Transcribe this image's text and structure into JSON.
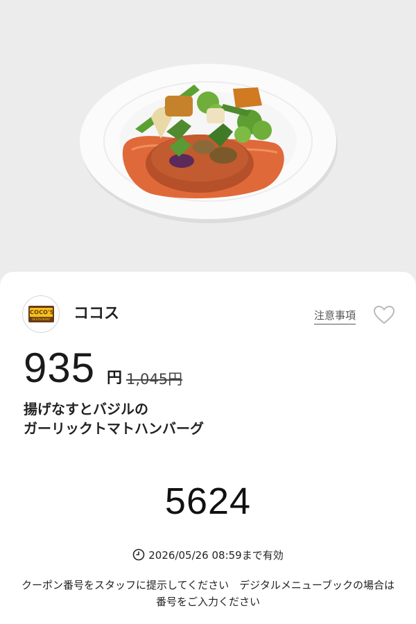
{
  "brand": {
    "name": "ココス",
    "logo_text": "COCO'S",
    "logo_subtext": "RESTAURANT"
  },
  "actions": {
    "notes_label": "注意事項",
    "favorite_icon": "heart-outline-icon"
  },
  "offer": {
    "price": "935",
    "currency": "円",
    "original_price": "1,045円",
    "title_line1": "揚げなすとバジルの",
    "title_line2": "ガーリックトマトハンバーグ"
  },
  "coupon": {
    "code": "5624",
    "expiry": "2026/05/26 08:59まで有効",
    "instructions": "クーポン番号をスタッフに提示してください　デジタルメニューブックの場合は番号をご入力ください"
  },
  "colors": {
    "background": "#ebebeb",
    "card": "#ffffff",
    "logo_brown": "#6b3a16",
    "logo_yellow": "#f4c21b"
  }
}
